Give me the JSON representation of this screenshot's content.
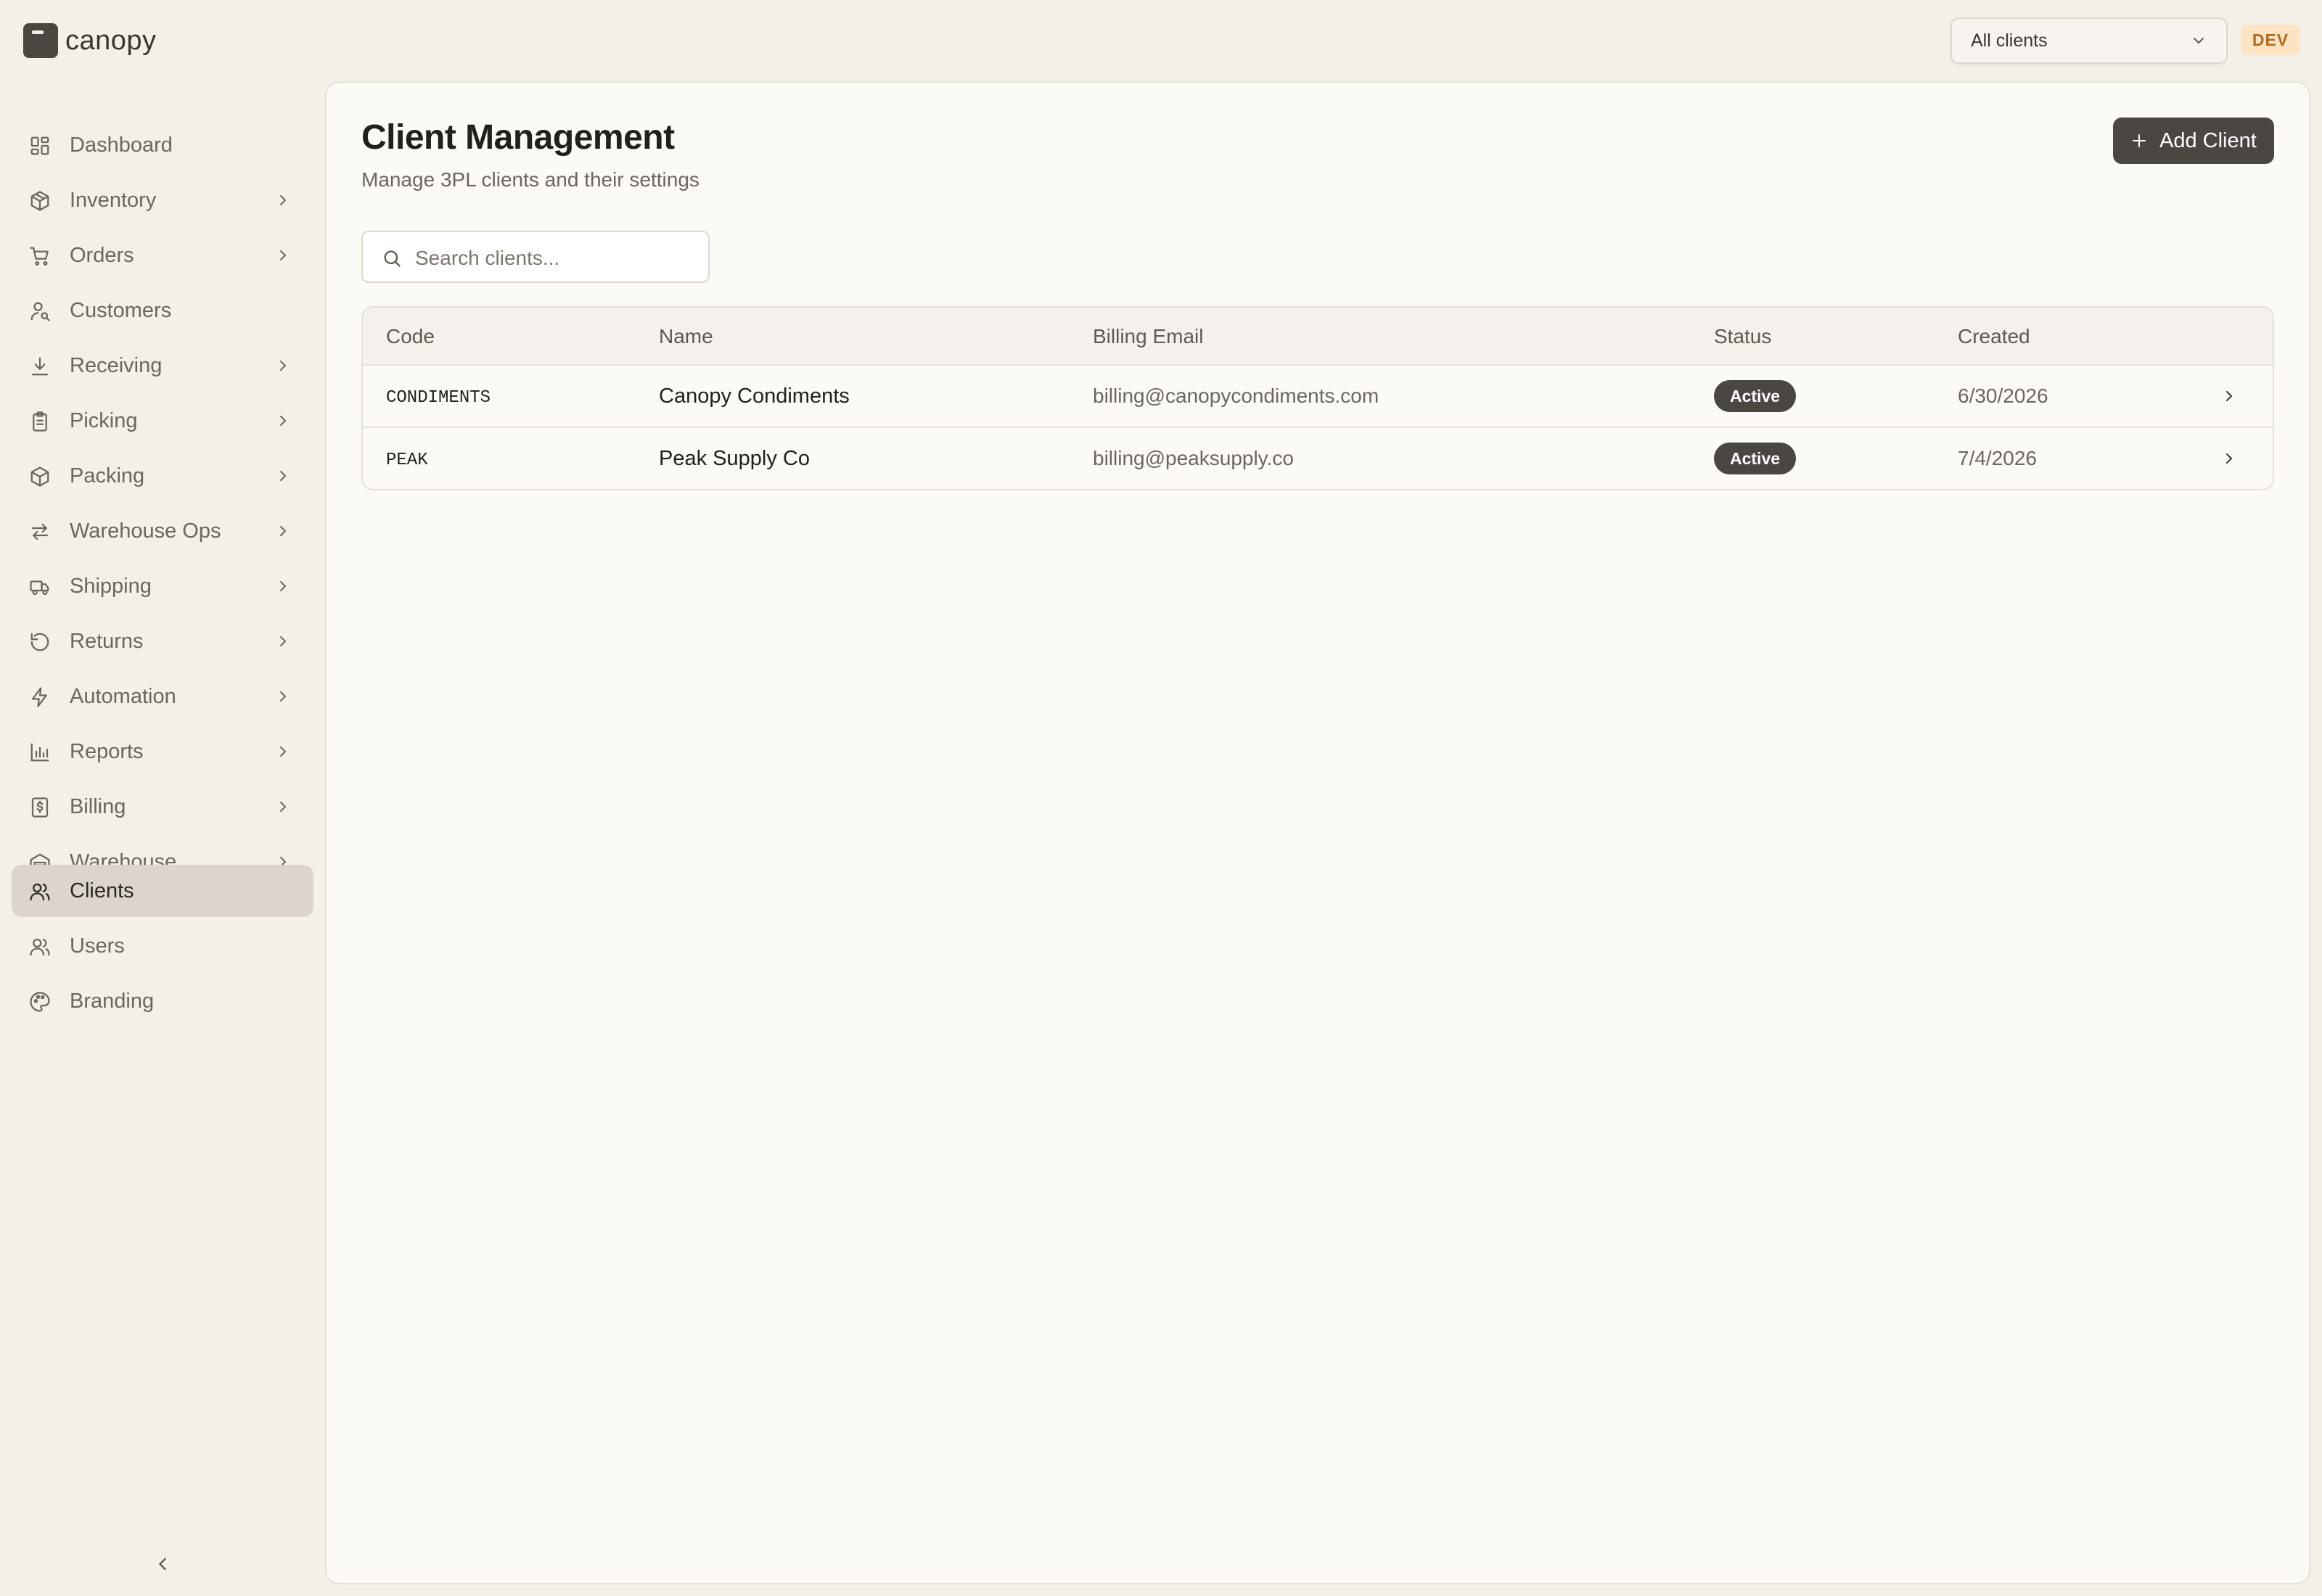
{
  "app": {
    "name": "canopy",
    "env_badge": "DEV"
  },
  "client_selector": {
    "value": "All clients"
  },
  "sidebar": {
    "items": [
      {
        "label": "Dashboard",
        "icon": "dashboard-icon",
        "has_children": false,
        "active": false
      },
      {
        "label": "Inventory",
        "icon": "box-icon",
        "has_children": true,
        "active": false
      },
      {
        "label": "Orders",
        "icon": "cart-icon",
        "has_children": true,
        "active": false
      },
      {
        "label": "Customers",
        "icon": "customer-icon",
        "has_children": false,
        "active": false
      },
      {
        "label": "Receiving",
        "icon": "download-icon",
        "has_children": true,
        "active": false
      },
      {
        "label": "Picking",
        "icon": "clipboard-icon",
        "has_children": true,
        "active": false
      },
      {
        "label": "Packing",
        "icon": "package-icon",
        "has_children": true,
        "active": false
      },
      {
        "label": "Warehouse Ops",
        "icon": "arrows-icon",
        "has_children": true,
        "active": false
      },
      {
        "label": "Shipping",
        "icon": "truck-icon",
        "has_children": true,
        "active": false
      },
      {
        "label": "Returns",
        "icon": "rotate-icon",
        "has_children": true,
        "active": false
      },
      {
        "label": "Automation",
        "icon": "bolt-icon",
        "has_children": true,
        "active": false
      },
      {
        "label": "Reports",
        "icon": "bar-chart-icon",
        "has_children": true,
        "active": false
      },
      {
        "label": "Billing",
        "icon": "receipt-icon",
        "has_children": true,
        "active": false
      },
      {
        "label": "Warehouse",
        "icon": "warehouse-icon",
        "has_children": true,
        "active": false
      },
      {
        "label": "Clients",
        "icon": "clients-icon",
        "has_children": false,
        "active": true
      },
      {
        "label": "Users",
        "icon": "users-icon",
        "has_children": false,
        "active": false
      },
      {
        "label": "Branding",
        "icon": "palette-icon",
        "has_children": false,
        "active": false
      }
    ]
  },
  "page": {
    "title": "Client Management",
    "subtitle": "Manage 3PL clients and their settings",
    "add_button_label": "Add Client",
    "search_placeholder": "Search clients..."
  },
  "table": {
    "columns": [
      "Code",
      "Name",
      "Billing Email",
      "Status",
      "Created"
    ],
    "rows": [
      {
        "code": "CONDIMENTS",
        "name": "Canopy Condiments",
        "email": "billing@canopycondiments.com",
        "status": "Active",
        "created": "6/30/2026"
      },
      {
        "code": "PEAK",
        "name": "Peak Supply Co",
        "email": "billing@peaksupply.co",
        "status": "Active",
        "created": "7/4/2026"
      }
    ]
  },
  "colors": {
    "background": "#f3efe9",
    "panel": "#fbfaf7",
    "accent": "#4a4641",
    "active_nav": "#dcd5cc",
    "env_badge_bg": "#fbe3c4",
    "env_badge_text": "#b36a1e"
  }
}
